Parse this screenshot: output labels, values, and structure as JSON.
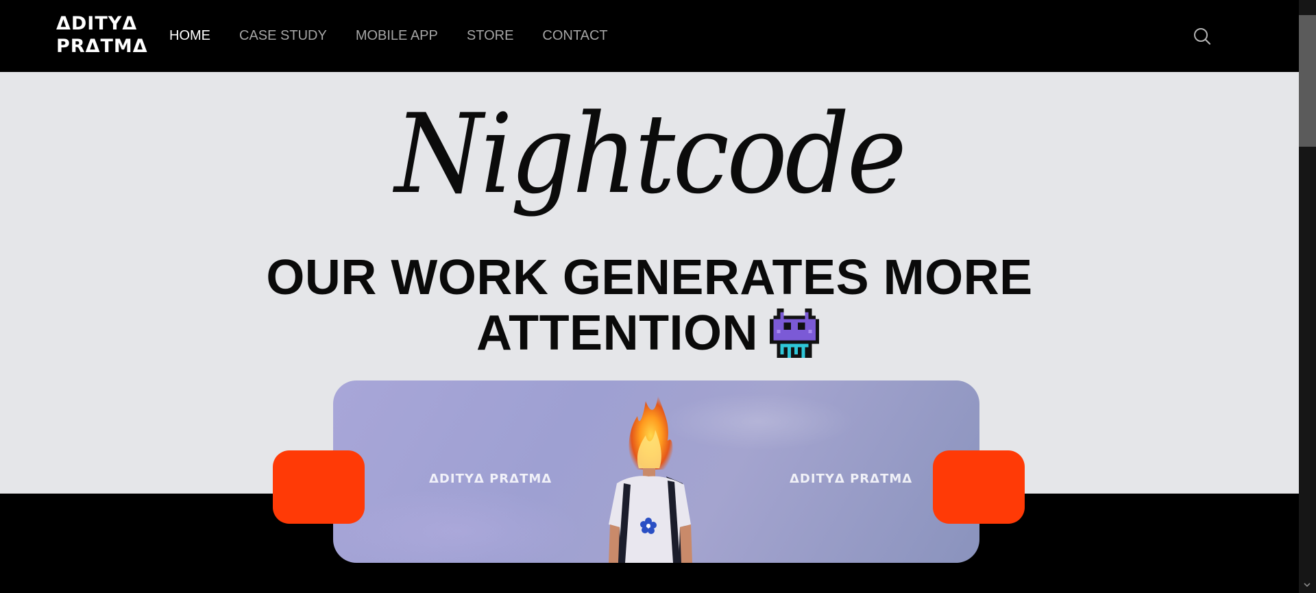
{
  "header": {
    "logo_line1": "ΔDITYΔ",
    "logo_line2": "PRΔTMΔ",
    "nav": [
      {
        "label": "HOME",
        "active": true
      },
      {
        "label": "CASE STUDY",
        "active": false
      },
      {
        "label": "MOBILE APP",
        "active": false
      },
      {
        "label": "STORE",
        "active": false
      },
      {
        "label": "CONTACT",
        "active": false
      }
    ],
    "search_icon": "search-icon"
  },
  "hero": {
    "script_title": "Nightcode",
    "headline_line1": "OUR WORK GENERATES MORE",
    "headline_line2": "ATTENTION",
    "emoji_icon": "pixel-alien-icon",
    "card": {
      "watermark_left": "ΔDITYΔ PRΔTMΔ",
      "watermark_right": "ΔDITYΔ PRΔTMΔ"
    }
  },
  "colors": {
    "header_bg": "#000000",
    "hero_bg": "#e5e6e9",
    "accent_orange": "#ff3a06",
    "nav_active": "#ffffff",
    "nav_inactive": "#a6a6a6",
    "alien_purple": "#7b5ad6",
    "alien_teal": "#2fc6d8"
  }
}
